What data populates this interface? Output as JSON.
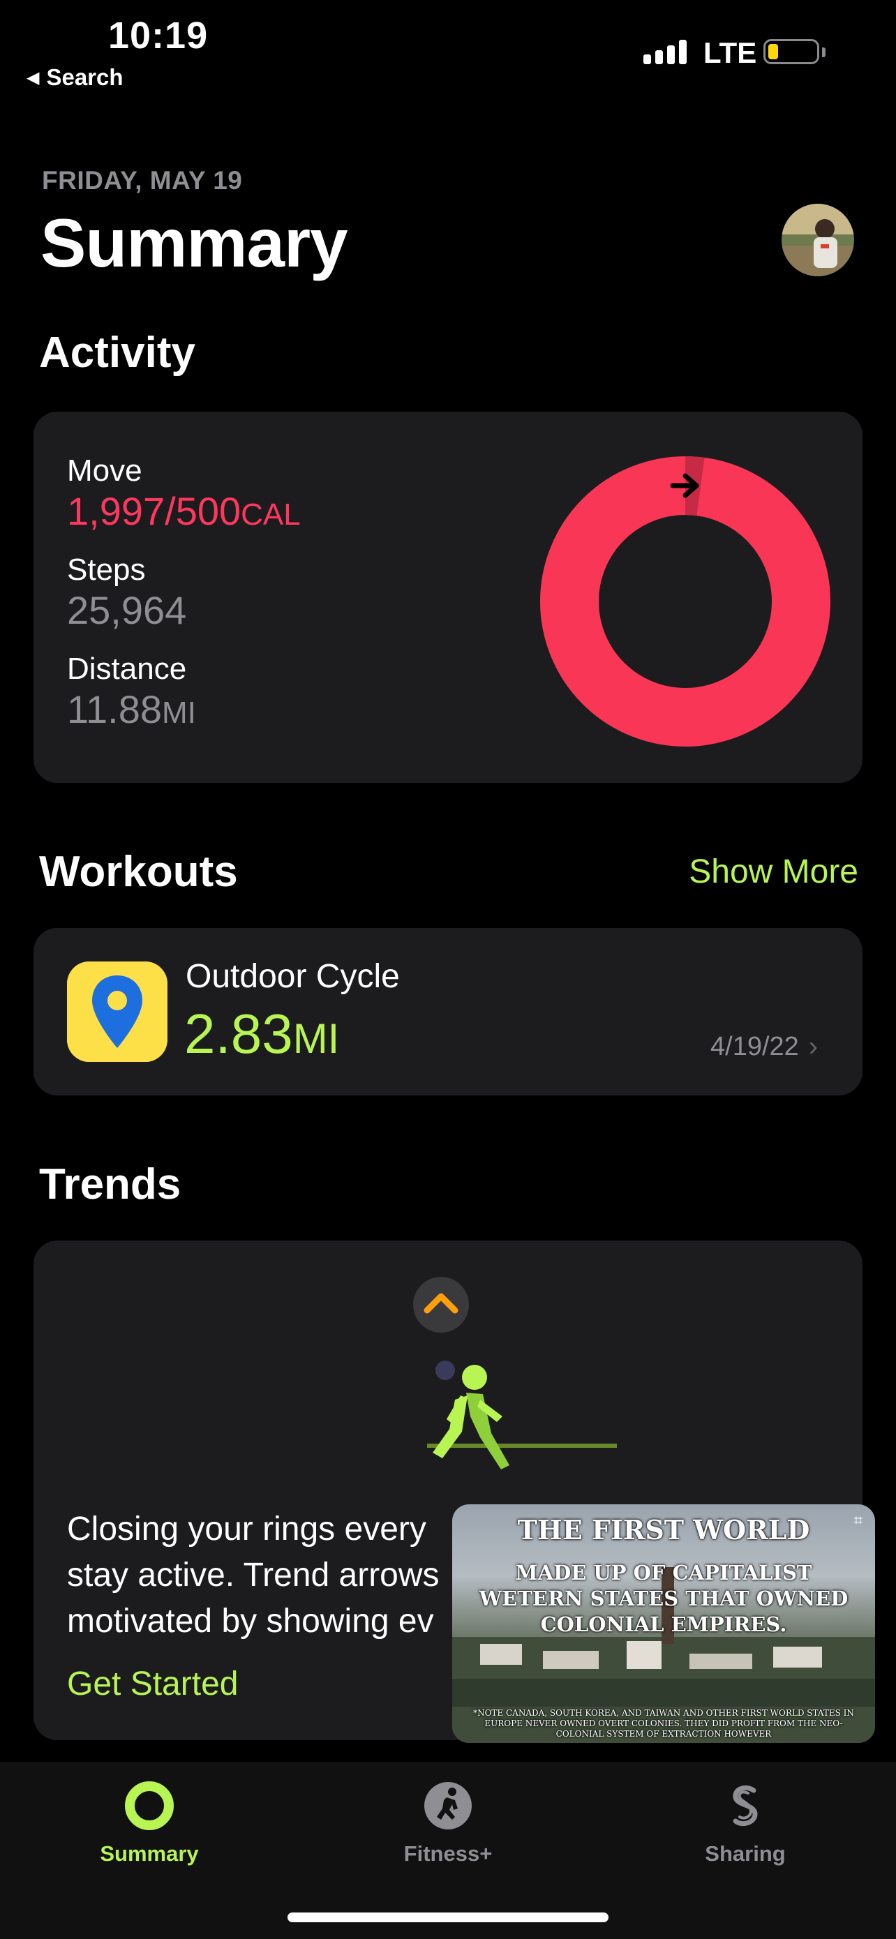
{
  "status_bar": {
    "time": "10:19",
    "back_label": "Search",
    "network": "LTE",
    "battery_level": 0.15
  },
  "header": {
    "date": "FRIDAY, MAY 19",
    "title": "Summary"
  },
  "activity": {
    "heading": "Activity",
    "move_label": "Move",
    "move_value": "1,997/500",
    "move_unit": "CAL",
    "steps_label": "Steps",
    "steps_value": "25,964",
    "distance_label": "Distance",
    "distance_value": "11.88",
    "distance_unit": "MI",
    "ring_progress": 3.99,
    "ring_color": "#fa3656"
  },
  "workouts": {
    "heading": "Workouts",
    "show_more": "Show More",
    "item": {
      "name": "Outdoor Cycle",
      "distance": "2.83",
      "unit": "MI",
      "date": "4/19/22"
    }
  },
  "trends": {
    "heading": "Trends",
    "line1": "Closing your rings every",
    "line2": "stay active. Trend arrows",
    "line3": "motivated by showing ev",
    "cta": "Get Started"
  },
  "pip_video": {
    "line1": "THE FIRST WORLD",
    "line2": "MADE UP OF CAPITALIST WETERN STATES THAT OWNED COLONIAL EMPIRES.",
    "fineprint": "*NOTE CANADA, SOUTH KOREA, AND TAIWAN AND OTHER FIRST WORLD STATES IN EUROPE NEVER OWNED OVERT COLONIES. THEY DID PROFIT FROM THE NEO-COLONIAL SYSTEM OF EXTRACTION HOWEVER"
  },
  "tabbar": {
    "tabs": [
      {
        "label": "Summary",
        "icon": "activity-ring-icon",
        "active": true
      },
      {
        "label": "Fitness+",
        "icon": "runner-icon",
        "active": false
      },
      {
        "label": "Sharing",
        "icon": "sharing-icon",
        "active": false
      }
    ],
    "active_color": "#b8f553",
    "inactive_color": "#8e8e93"
  }
}
